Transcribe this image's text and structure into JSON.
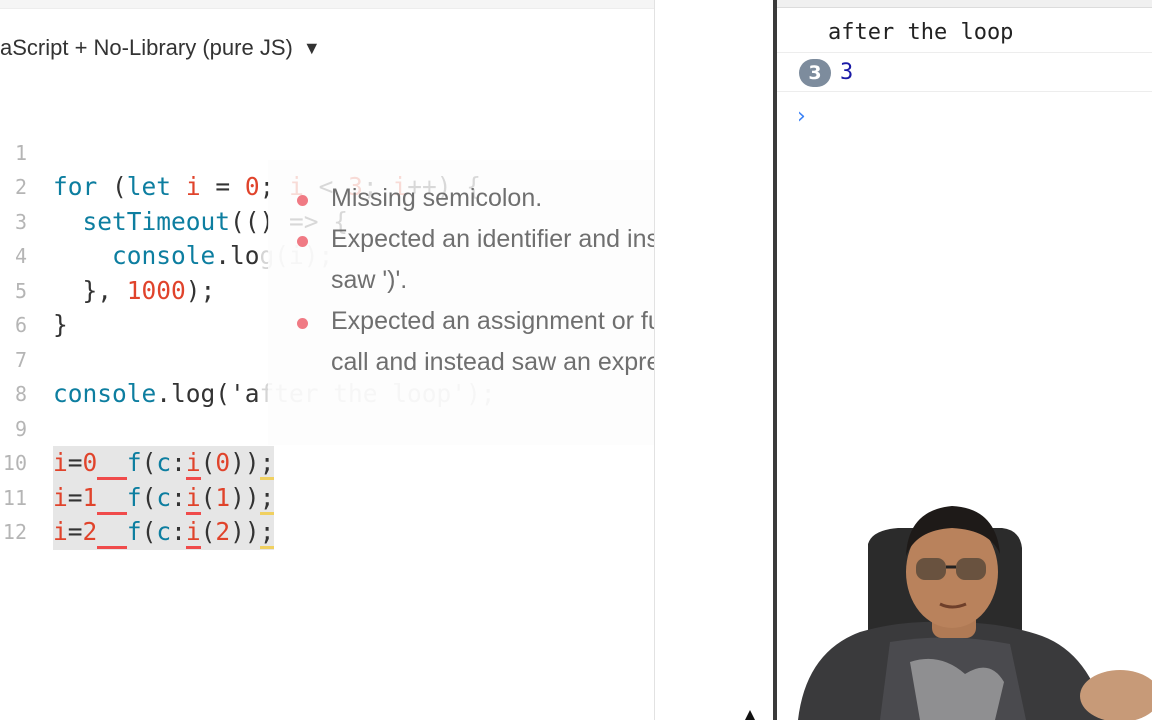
{
  "editor": {
    "language_label": "aScript + No-Library (pure JS)",
    "language_caret": "▼",
    "lines": [
      {
        "num": "1",
        "code": "for (let i = 0; i < 3; i++) {"
      },
      {
        "num": "2",
        "code": "  setTimeout(() => {"
      },
      {
        "num": "3",
        "code": "    console.log(i);"
      },
      {
        "num": "4",
        "code": "  }, 1000);"
      },
      {
        "num": "5",
        "code": "}"
      },
      {
        "num": "6",
        "code": ""
      },
      {
        "num": "7",
        "code": "console.log('after the loop');"
      },
      {
        "num": "8",
        "code": ""
      },
      {
        "num": "9",
        "code": "i=0  f(c:i(0));"
      },
      {
        "num": "10",
        "code": "i=1  f(c:i(1));"
      },
      {
        "num": "11",
        "code": "i=2  f(c:i(2));"
      },
      {
        "num": "12",
        "code": ""
      }
    ]
  },
  "lint_tooltip": {
    "messages": [
      "Missing semicolon.",
      "Expected an identifier and instead saw ')'.",
      "Expected an assignment or function call and instead saw an expression."
    ]
  },
  "console": {
    "log_message": "after the loop",
    "repeat_count": "3",
    "repeat_value": "3",
    "prompt_symbol": "›"
  },
  "colors": {
    "keyword": "#0d7ea0",
    "number": "#e0432b",
    "lint_dot": "#f07a84",
    "console_badge": "#7d8c9d",
    "console_value": "#1a1aa6",
    "prompt": "#3b82f6"
  },
  "icons": {
    "language_caret": "chevron-down-icon",
    "lint_marker": "error-dot-icon",
    "console_prompt": "chevron-right-icon",
    "mouse_cursor": "cursor-icon"
  }
}
